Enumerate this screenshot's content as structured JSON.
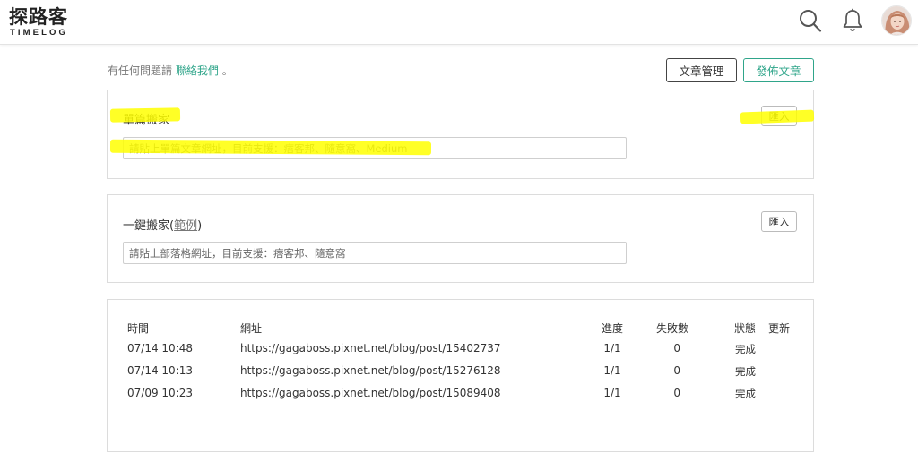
{
  "header": {
    "logo_cn": "探路客",
    "logo_en": "TIMELOG",
    "icons": [
      "search-icon",
      "bell-icon",
      "avatar"
    ]
  },
  "topbar": {
    "contact_prefix": "有任何問題請",
    "contact_link": "聯絡我們",
    "contact_suffix": "。",
    "manage_label": "文章管理",
    "publish_label": "發佈文章"
  },
  "single": {
    "title": "單篇搬家",
    "import_label": "匯入",
    "placeholder": "請貼上單篇文章網址，目前支援：痞客邦、隨意窩、Medium"
  },
  "bulk": {
    "title_prefix": "一鍵搬家(",
    "example_link": "範例",
    "title_suffix": ")",
    "import_label": "匯入",
    "placeholder": "請貼上部落格網址，目前支援：痞客邦、隨意窩"
  },
  "table": {
    "headers": {
      "time": "時間",
      "url": "網址",
      "progress": "進度",
      "fail": "失敗數",
      "status": "狀態",
      "update": "更新"
    },
    "rows": [
      {
        "time": "07/14 10:48",
        "url": "https://gagaboss.pixnet.net/blog/post/15402737",
        "progress": "1/1",
        "fail": "0",
        "status": "完成"
      },
      {
        "time": "07/14 10:13",
        "url": "https://gagaboss.pixnet.net/blog/post/15276128",
        "progress": "1/1",
        "fail": "0",
        "status": "完成"
      },
      {
        "time": "07/09 10:23",
        "url": "https://gagaboss.pixnet.net/blog/post/15089408",
        "progress": "1/1",
        "fail": "0",
        "status": "完成"
      }
    ]
  },
  "colors": {
    "accent": "#2fa58a",
    "highlight": "#ffff00",
    "border": "#dcdcdc"
  }
}
